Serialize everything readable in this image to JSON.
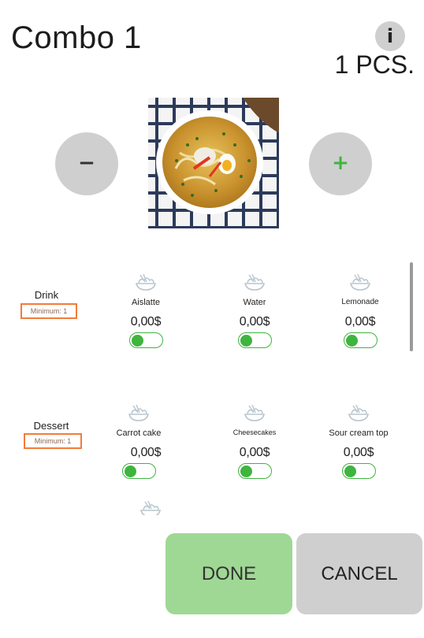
{
  "header": {
    "title": "Combo 1",
    "info_label": "i",
    "quantity": "1 PCS."
  },
  "stepper": {
    "minus_label": "−",
    "plus_label": "+"
  },
  "groups": [
    {
      "label": "Drink",
      "minimum": "Minimum: 1",
      "items": [
        {
          "name": "Aislatte",
          "price": "0,00$",
          "toggle_on": true
        },
        {
          "name": "Water",
          "price": "0,00$",
          "toggle_on": true
        },
        {
          "name": "Lemonade",
          "price": "0,00$",
          "toggle_on": true
        }
      ]
    },
    {
      "label": "Dessert",
      "minimum": "Minimum: 1",
      "items": [
        {
          "name": "Carrot cake",
          "price": "0,00$",
          "toggle_on": true
        },
        {
          "name": "Cheesecakes",
          "price": "0,00$",
          "toggle_on": true
        },
        {
          "name": "Sour cream top",
          "price": "0,00$",
          "toggle_on": true
        }
      ]
    }
  ],
  "footer": {
    "done_label": "DONE",
    "cancel_label": "CANCEL"
  },
  "colors": {
    "accent_green": "#3fb43f",
    "done_bg": "#9fd894",
    "neutral_button": "#cfcfcf",
    "minimum_border": "#f27c3a"
  },
  "icons": {
    "product_placeholder": "food-bowl-icon",
    "info": "info-icon"
  }
}
